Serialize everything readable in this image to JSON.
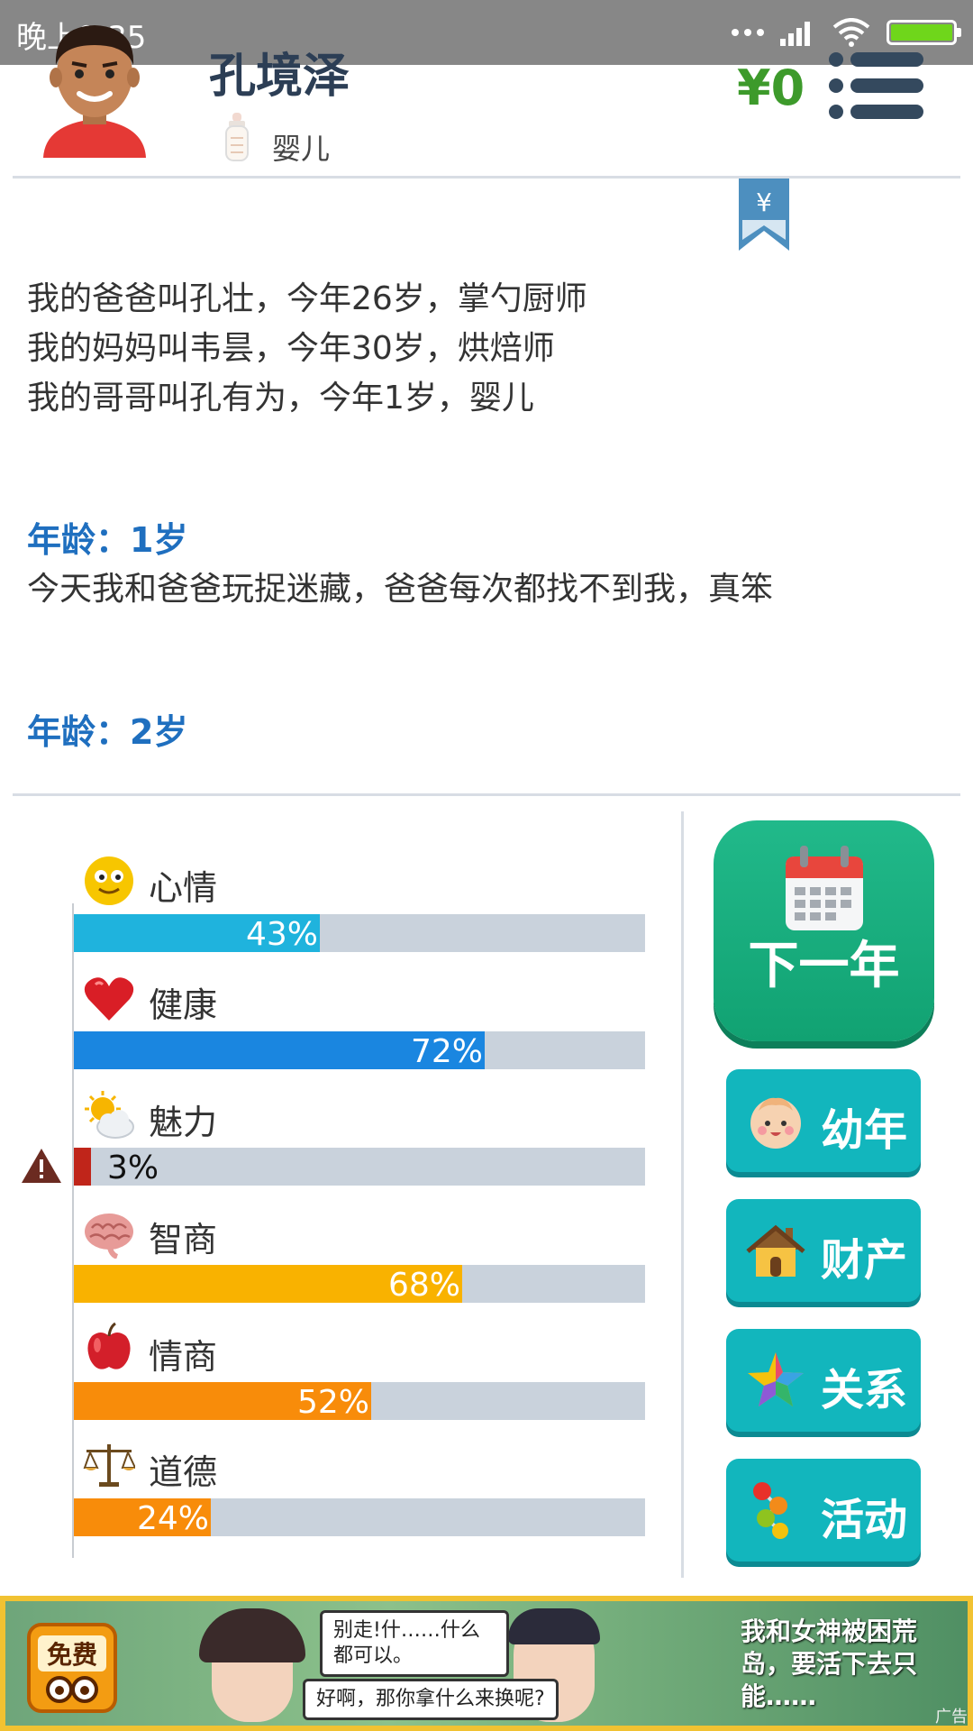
{
  "status_bar": {
    "time": "晚上9:35"
  },
  "header": {
    "name": "孔境泽",
    "stage": "婴儿",
    "money": "¥0"
  },
  "bookmark": {
    "symbol": "¥"
  },
  "log": {
    "family": [
      "我的爸爸叫孔壮，今年26岁，掌勺厨师",
      "我的妈妈叫韦昙，今年30岁，烘焙师",
      "我的哥哥叫孔有为，今年1岁，婴儿"
    ],
    "entries": [
      {
        "age": "年龄：1岁",
        "text": "今天我和爸爸玩捉迷藏，爸爸每次都找不到我，真笨"
      },
      {
        "age": "年龄：2岁",
        "text": ""
      }
    ]
  },
  "stats": [
    {
      "label": "心情",
      "value": 43,
      "text": "43%",
      "color": "#1fb3dd",
      "icon": "smiley-icon"
    },
    {
      "label": "健康",
      "value": 72,
      "text": "72%",
      "color": "#1a86e0",
      "icon": "heart-icon"
    },
    {
      "label": "魅力",
      "value": 3,
      "text": "3%",
      "color": "#c0251a",
      "icon": "sun-cloud-icon",
      "warning": true
    },
    {
      "label": "智商",
      "value": 68,
      "text": "68%",
      "color": "#f9b200",
      "icon": "brain-icon"
    },
    {
      "label": "情商",
      "value": 52,
      "text": "52%",
      "color": "#f88c0a",
      "icon": "apple-icon"
    },
    {
      "label": "道德",
      "value": 24,
      "text": "24%",
      "color": "#f88c0a",
      "icon": "scales-icon"
    }
  ],
  "actions": {
    "next_year": "下一年",
    "childhood": "幼年",
    "property": "财产",
    "relations": "关系",
    "activities": "活动"
  },
  "ad": {
    "badge": "免费",
    "bubble1": "别走!什……什么都可以。",
    "bubble2": "好啊，那你拿什么来换呢?",
    "headline": "我和女神被困荒岛，要活下去只能……",
    "tag": "广告"
  }
}
